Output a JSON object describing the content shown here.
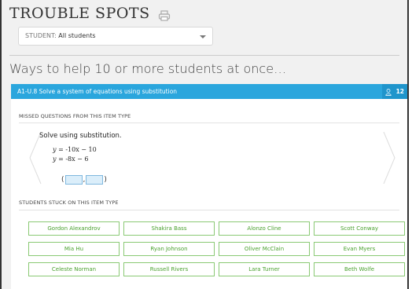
{
  "page": {
    "title": "TROUBLE SPOTS",
    "student_filter": {
      "label": "STUDENT:",
      "value": "All students"
    },
    "heading": "Ways to help 10 or more students at once…"
  },
  "skill": {
    "name": "A1-U.8 Solve a system of equations using substitution",
    "student_count": "12"
  },
  "missed": {
    "label": "MISSED QUESTIONS FROM THIS ITEM TYPE",
    "prompt": "Solve using substitution.",
    "equations": [
      {
        "var": "y",
        "rhs": "= ‑10x − 10"
      },
      {
        "var": "y",
        "rhs": "= ‑8x − 6"
      }
    ],
    "answer_open": "(",
    "answer_comma": ",",
    "answer_close": ")"
  },
  "stuck": {
    "label": "STUDENTS STUCK ON THIS ITEM TYPE",
    "students": [
      "Gordon Alexandrov",
      "Shakira Bass",
      "Alonzo Cline",
      "Scott Conway",
      "Mia Hu",
      "Ryan Johnson",
      "Oliver McClain",
      "Evan Myers",
      "Celeste Norman",
      "Russell Rivers",
      "Lara Turner",
      "Beth Wolfe"
    ]
  },
  "colors": {
    "skill_bar": "#2aa6dd",
    "student_border": "#8ac974",
    "student_text": "#4aa12f"
  },
  "icons": [
    "print-icon",
    "chevron-down-icon",
    "user-icon",
    "chevron-left-icon",
    "chevron-right-icon"
  ]
}
